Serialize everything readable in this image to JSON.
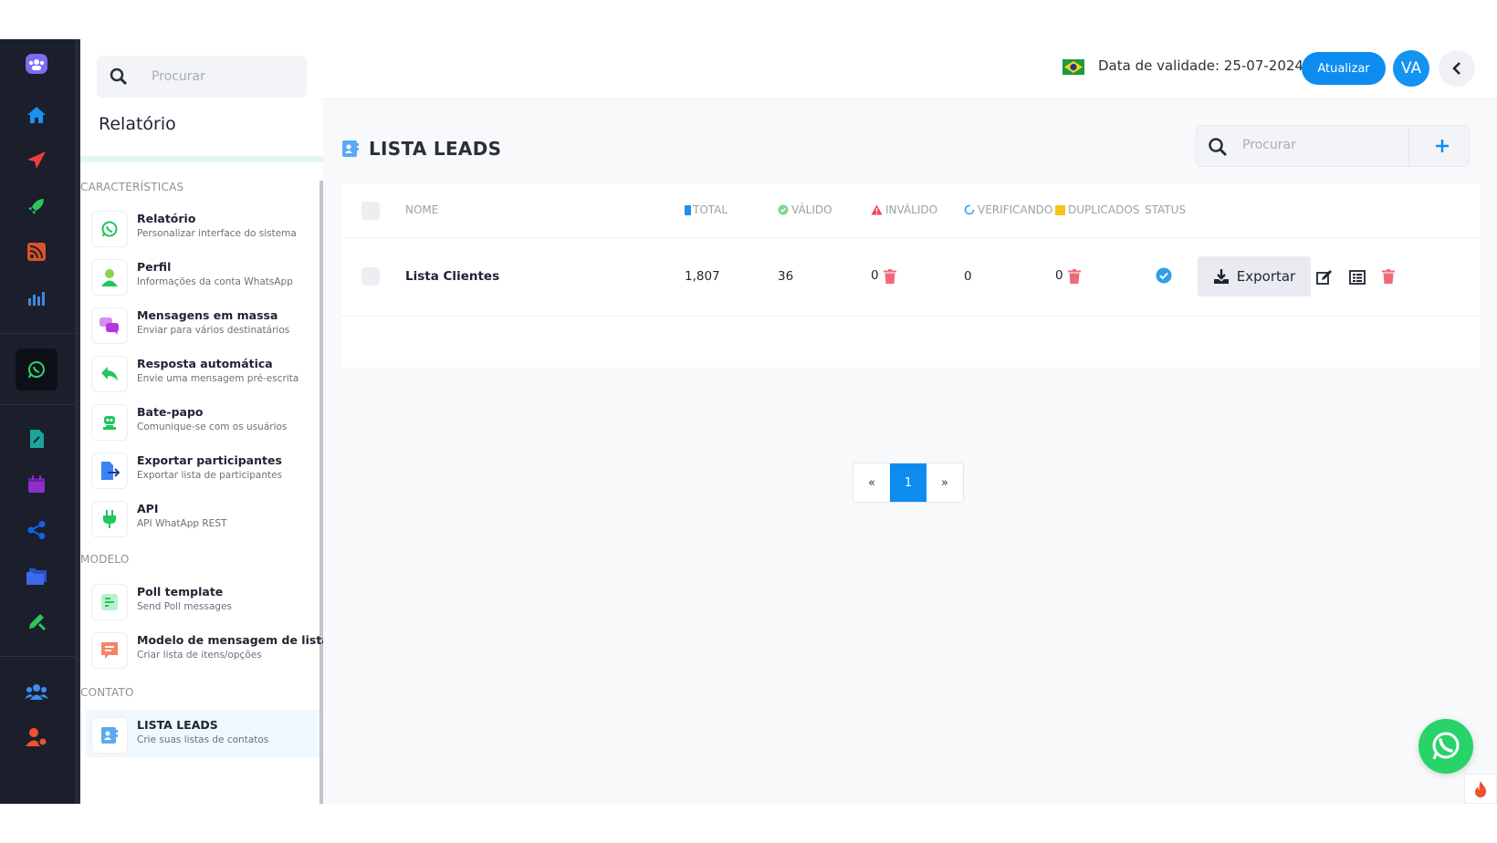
{
  "sidebar": {
    "search_placeholder": "Procurar",
    "title": "Relatório",
    "sections": {
      "features": "CARACTERÍSTICAS",
      "model": "MODELO",
      "contact": "CONTATO"
    },
    "items": [
      {
        "name": "Relatório",
        "desc": "Personalizar interface do sistema",
        "icon": "whatsapp-icon"
      },
      {
        "name": "Perfil",
        "desc": "Informações da conta WhatsApp",
        "icon": "user-icon"
      },
      {
        "name": "Mensagens em massa",
        "desc": "Enviar para vários destinatários",
        "icon": "chat-bubbles-icon"
      },
      {
        "name": "Resposta automática",
        "desc": "Envie uma mensagem pré-escrita",
        "icon": "reply-icon"
      },
      {
        "name": "Bate-papo",
        "desc": "Comunique-se com os usuários",
        "icon": "robot-icon"
      },
      {
        "name": "Exportar participantes",
        "desc": "Exportar lista de participantes",
        "icon": "file-export-icon"
      },
      {
        "name": "API",
        "desc": "API WhatApp REST",
        "icon": "plug-icon"
      },
      {
        "name": "Poll template",
        "desc": "Send Poll messages",
        "icon": "poll-icon"
      },
      {
        "name": "Modelo de mensagem de lista",
        "desc": "Criar lista de itens/opções",
        "icon": "list-message-icon"
      },
      {
        "name": "LISTA LEADS",
        "desc": "Crie suas listas de contatos",
        "icon": "contact-list-icon"
      }
    ]
  },
  "topbar": {
    "validity": "Data de validade: 25-07-2024",
    "update_label": "Atualizar",
    "avatar_initials": "VA"
  },
  "page": {
    "title": "LISTA LEADS",
    "search_placeholder": "Procurar"
  },
  "table": {
    "headers": {
      "name": "NOME",
      "total": "TOTAL",
      "valid": "VÁLIDO",
      "invalid": "INVÁLIDO",
      "verifying": "VERIFICANDO",
      "duplicates": "DUPLICADOS",
      "status": "STATUS"
    },
    "rows": [
      {
        "name": "Lista Clientes",
        "total": "1,807",
        "valid": "36",
        "invalid": "0",
        "verifying": "0",
        "duplicates": "0",
        "export_label": "Exportar"
      }
    ]
  },
  "pagination": {
    "prev": "«",
    "current": "1",
    "next": "»"
  },
  "colors": {
    "accent": "#0d8cf0",
    "rail_bg": "#1b1e2b",
    "whatsapp": "#28d469",
    "danger": "#f0697a"
  }
}
